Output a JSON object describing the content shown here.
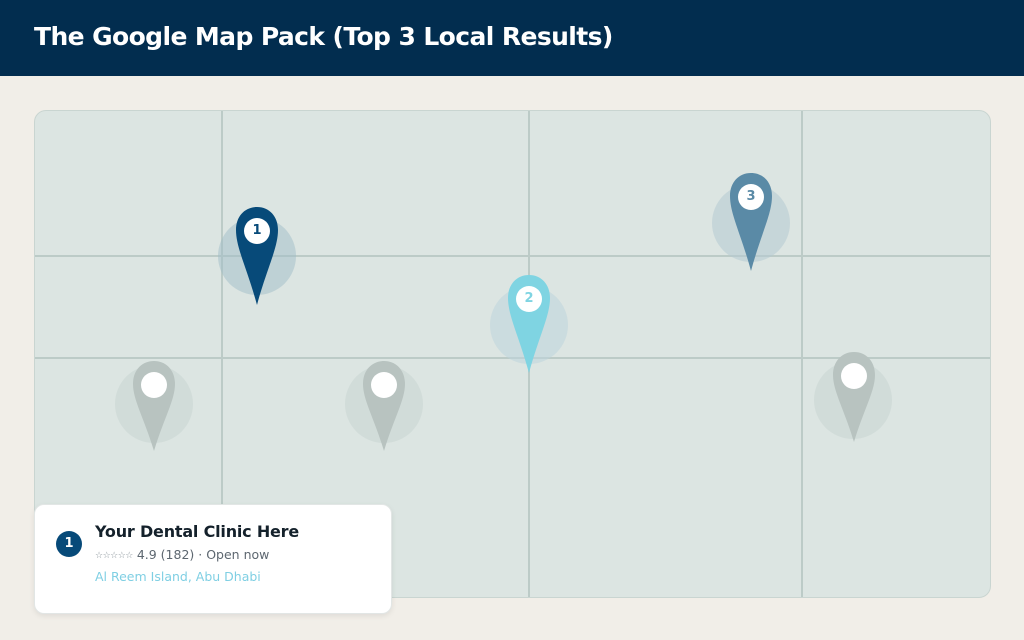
{
  "header": {
    "title": "The Google Map Pack (Top 3 Local Results)"
  },
  "colors": {
    "header_bg": "#022d4f",
    "page_bg": "#f1eee8",
    "map_bg": "#dce5e2",
    "pin_rank_1": "#074a79",
    "pin_rank_2": "#7fd4e2",
    "pin_rank_3": "#5a8aa6",
    "pin_unranked": "#b8c3c0"
  },
  "map": {
    "ranked_pins": [
      {
        "rank": "1",
        "icon": "map-pin-icon"
      },
      {
        "rank": "2",
        "icon": "map-pin-icon"
      },
      {
        "rank": "3",
        "icon": "map-pin-icon"
      }
    ],
    "unranked_pin_count": 3
  },
  "result_card": {
    "rank": "1",
    "name": "Your Dental Clinic Here",
    "stars_icon": "five-star-rating-icon",
    "rating_text": "4.9 (182) · Open now",
    "address": "Al Reem Island, Abu Dhabi"
  }
}
